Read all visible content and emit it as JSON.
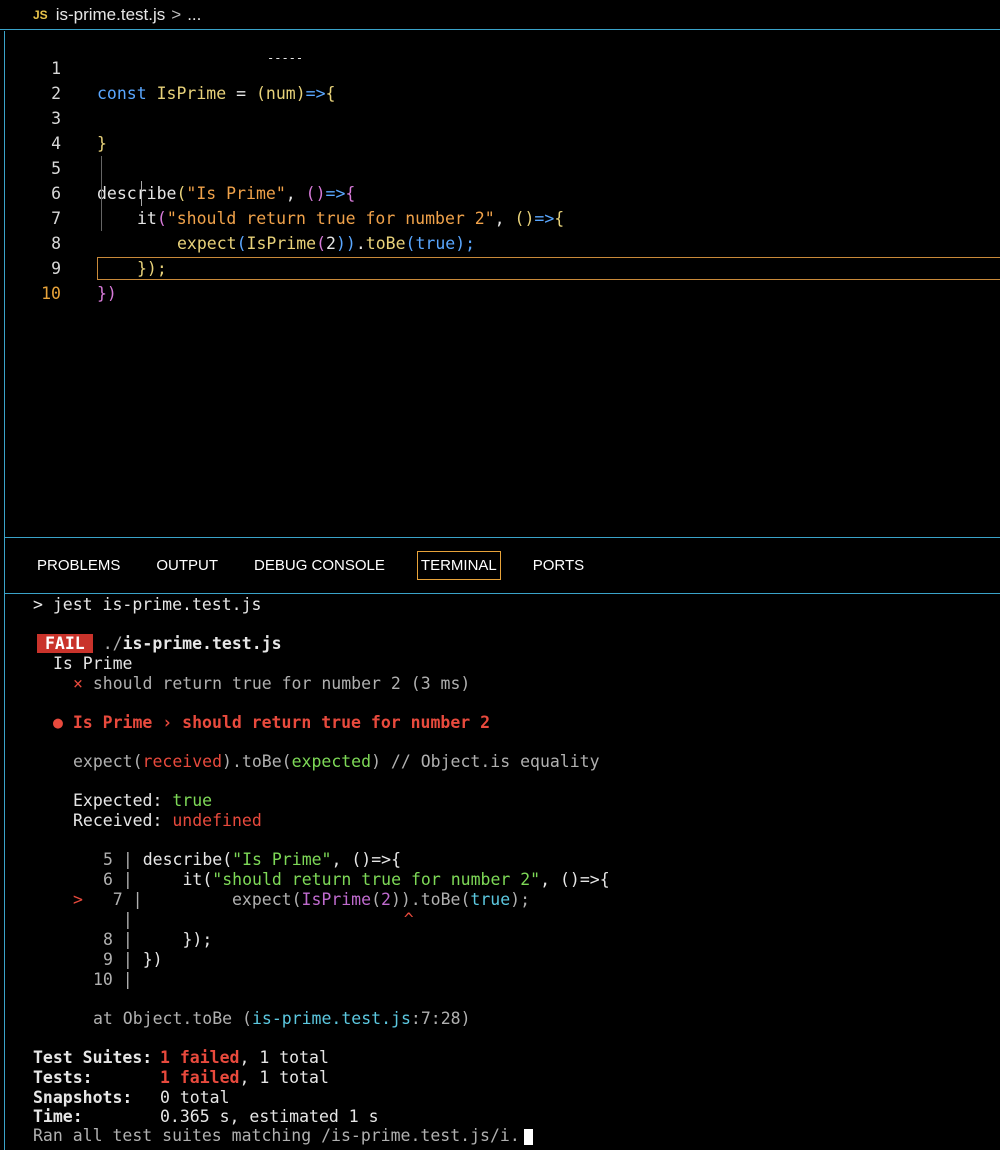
{
  "breadcrumb": {
    "icon": "JS",
    "file": "is-prime.test.js",
    "separator": ">",
    "more": "..."
  },
  "editor": {
    "line_numbers": [
      "1",
      "2",
      "3",
      "4",
      "5",
      "6",
      "7",
      "8",
      "9",
      "10"
    ],
    "active_line": "10",
    "lines": {
      "l1": {
        "kw": "const",
        "name": " IsPrime",
        "eq": " = ",
        "p1": "(",
        "arg": "num",
        "p2": ")",
        "arrow": "=>",
        "brace": "{"
      },
      "l3": {
        "brace": "}"
      },
      "l5": {
        "fn": "describe",
        "p1": "(",
        "str": "\"Is Prime\"",
        "comma": ", ",
        "p2": "()",
        "arrow": "=>",
        "brace": "{"
      },
      "l6": {
        "fn": "it",
        "p1": "(",
        "str": "\"should return true for number 2\"",
        "comma": ", ",
        "p2": "()",
        "arrow": "=>",
        "brace": "{"
      },
      "l7": {
        "fn": "expect",
        "p1": "(",
        "call": "IsPrime",
        "p2": "(",
        "num": "2",
        "p3": "))",
        "dot": ".",
        "method": "toBe",
        "p4": "(",
        "val": "true",
        "p5": ");"
      },
      "l8": {
        "close": "});"
      },
      "l9": {
        "close": "})"
      }
    },
    "squiggle": "-----"
  },
  "panel": {
    "tabs": [
      "PROBLEMS",
      "OUTPUT",
      "DEBUG CONSOLE",
      "TERMINAL",
      "PORTS"
    ],
    "active_tab": "TERMINAL"
  },
  "terminal": {
    "command": "> jest is-prime.test.js",
    "fail_badge": "FAIL",
    "file_prefix": "./",
    "file": "is-prime.test.js",
    "suite": "Is Prime",
    "test_result_mark": "×",
    "test_result": "should return true for number 2 (3 ms)",
    "error_title_bullet": "●",
    "error_title": "Is Prime › should return true for number 2",
    "matcher": {
      "expect": "expect(",
      "received": "received",
      "mid": ").toBe(",
      "expected": "expected",
      "end": ")",
      "comment": " // Object.is equality"
    },
    "expected_label": "Expected: ",
    "expected_value": "true",
    "received_label": "Received: ",
    "received_value": "undefined",
    "snippet": {
      "l5_num": "5",
      "l5_code_a": "describe(",
      "l5_str": "\"Is Prime\"",
      "l5_code_b": ", ()=>{",
      "l6_num": "6",
      "l6_code_a": "    it(",
      "l6_str": "\"should return true for number 2\"",
      "l6_code_b": ", ()=>{",
      "marker": ">",
      "l7_num": "7",
      "l7_code_a": "        expect(",
      "l7_call": "IsPrime",
      "l7_code_b": "(",
      "l7_num_arg": "2",
      "l7_code_c": ")).toBe(",
      "l7_val": "true",
      "l7_code_d": ");",
      "caret": "^",
      "l8_num": "8",
      "l8_code": "    });",
      "l9_num": "9",
      "l9_code": "})",
      "l10_num": "10"
    },
    "at_prefix": "at Object.toBe (",
    "at_file": "is-prime.test.js",
    "at_loc": ":7:28)",
    "summary": {
      "suites_label": "Test Suites:",
      "suites_failed": "1 failed",
      "suites_rest": ", 1 total",
      "tests_label": "Tests:",
      "tests_failed": "1 failed",
      "tests_rest": ", 1 total",
      "snapshots_label": "Snapshots:",
      "snapshots_value": "0 total",
      "time_label": "Time:",
      "time_value": "0.365 s, estimated 1 s",
      "ran_text": "Ran all test suites matching /is-prime.test.js/i."
    }
  }
}
